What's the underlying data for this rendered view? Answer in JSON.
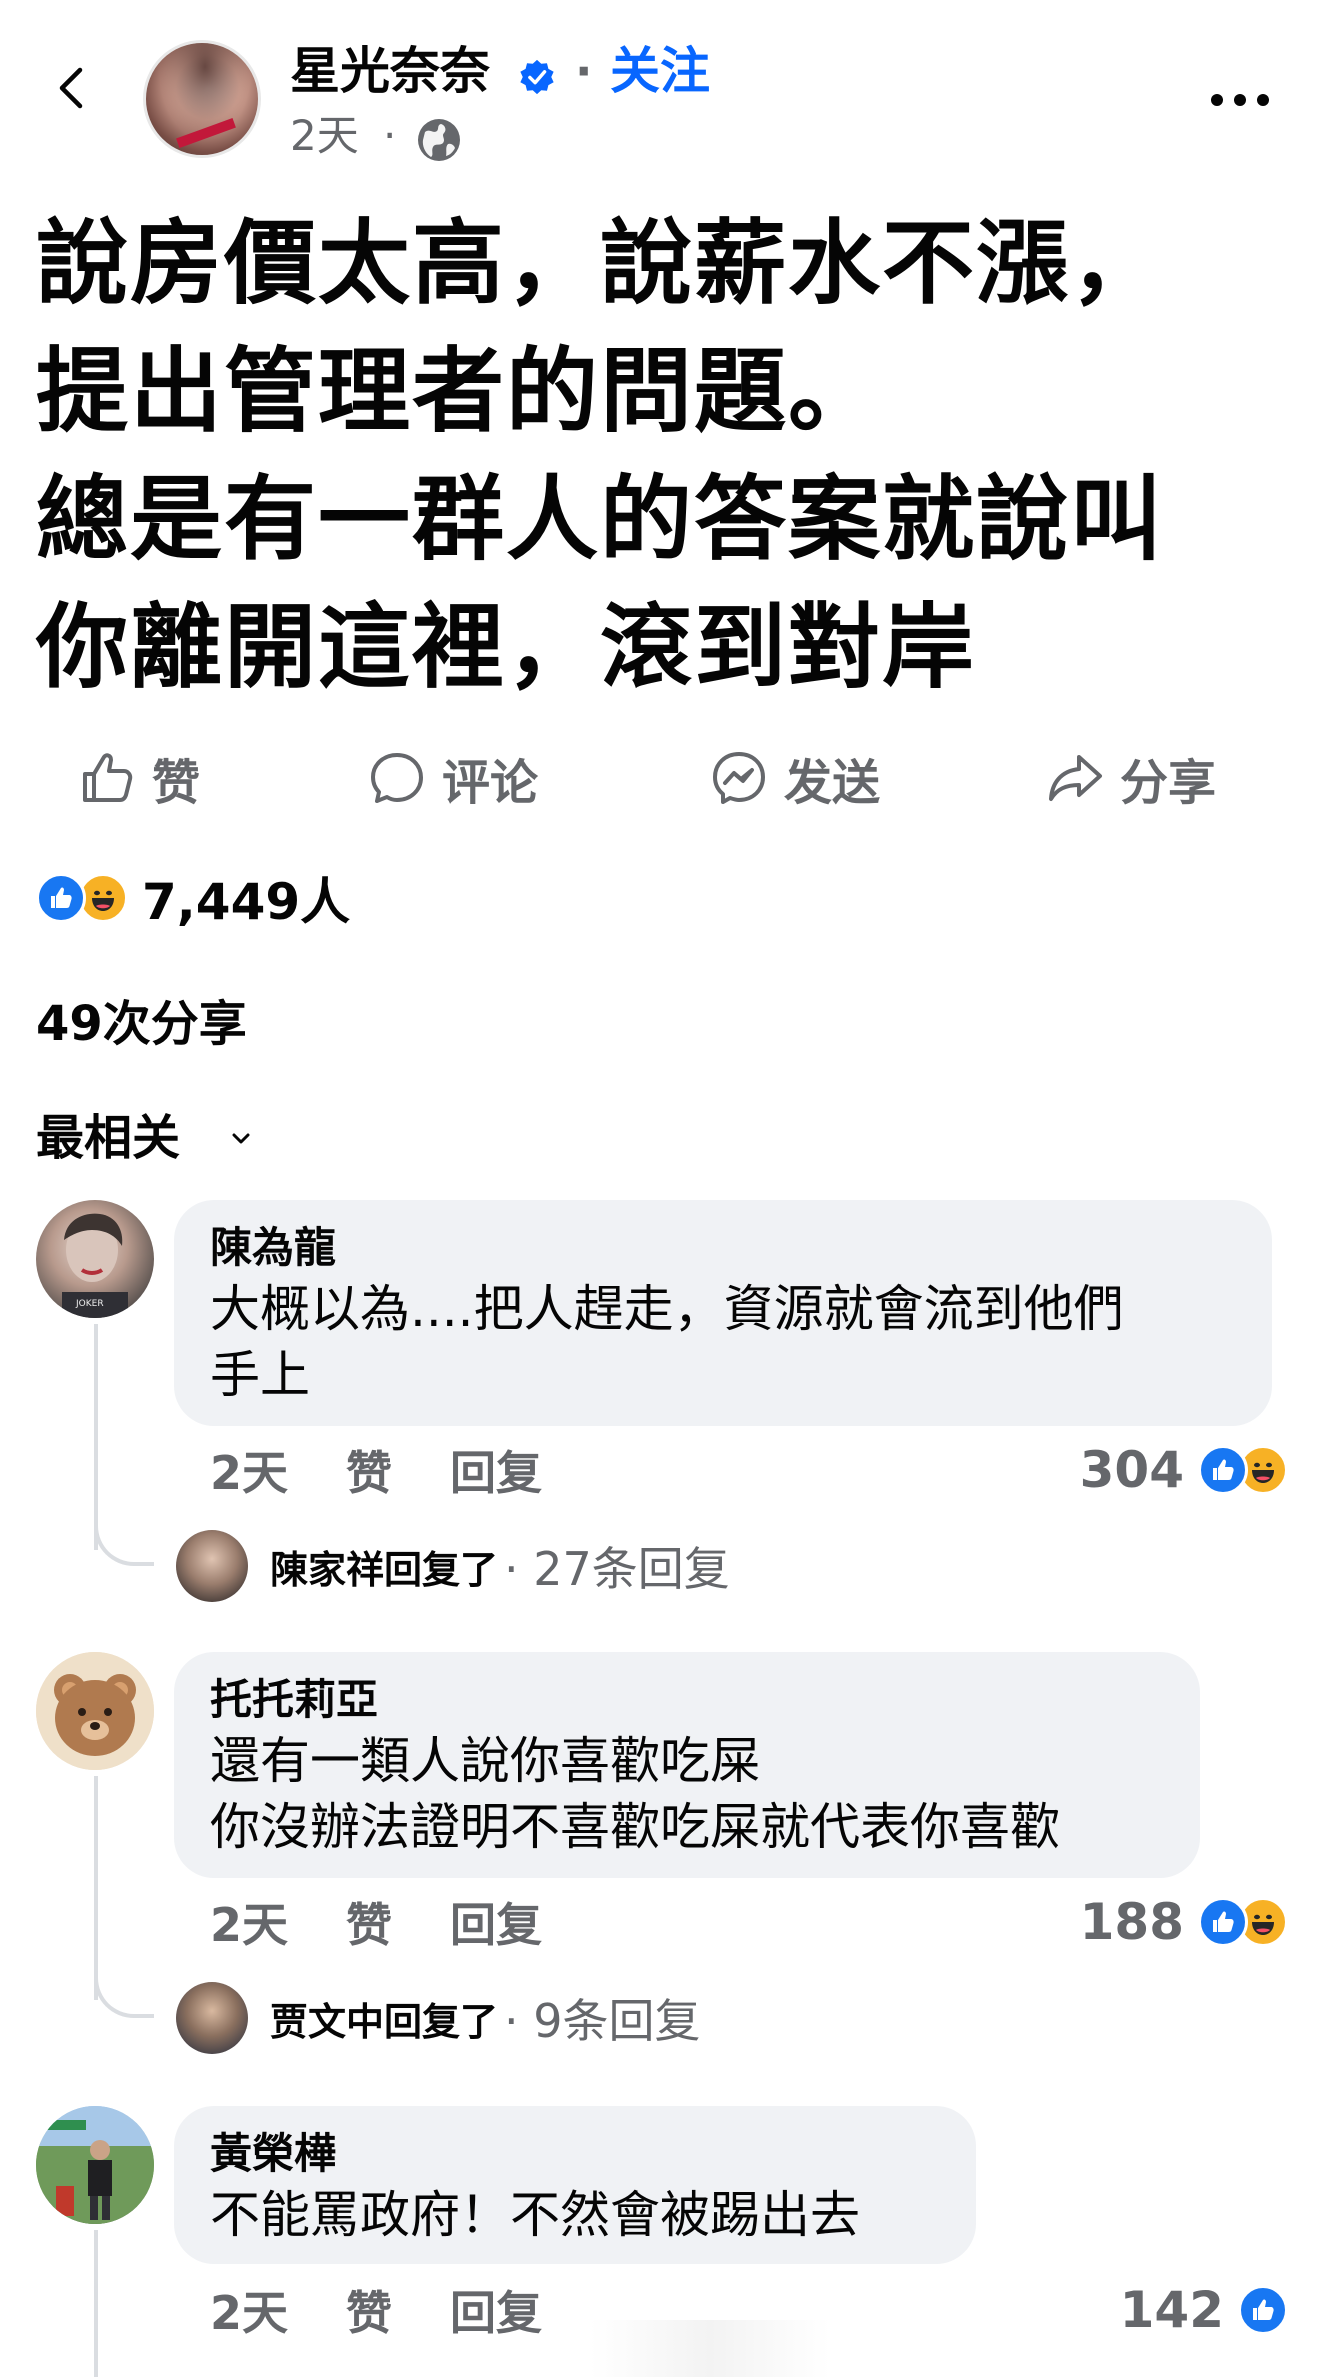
{
  "header": {
    "author_name": "星光奈奈",
    "dot": "·",
    "follow_label": "关注",
    "post_time": "2天",
    "time_dot": "·",
    "icons": [
      "chevron-left-icon",
      "verified-badge-icon",
      "globe-icon",
      "more-horizontal-icon"
    ]
  },
  "post": {
    "text_lines": [
      "說房價太高，說薪水不漲，",
      "提出管理者的問題。",
      "總是有一群人的答案就說叫",
      "你離開這裡，滾到對岸"
    ]
  },
  "actions": {
    "like_label": "赞",
    "comment_label": "评论",
    "send_label": "发送",
    "share_label": "分享"
  },
  "stats": {
    "reaction_count": "7,449人",
    "share_count": "49次分享",
    "sort_label": "最相关"
  },
  "comments": [
    {
      "name": "陳為龍",
      "lines": [
        "大概以為....把人趕走，資源就會流到他們",
        "手上"
      ],
      "time": "2天",
      "like_label": "赞",
      "reply_label": "回复",
      "reaction_count": "304",
      "reply_author": "陳家祥回复了",
      "reply_count": "· 27条回复"
    },
    {
      "name": "托托莉亞",
      "lines": [
        "還有一類人說你喜歡吃屎",
        "你沒辦法證明不喜歡吃屎就代表你喜歡"
      ],
      "time": "2天",
      "like_label": "赞",
      "reply_label": "回复",
      "reaction_count": "188",
      "reply_author": "贾文中回复了",
      "reply_count": "· 9条回复"
    },
    {
      "name": "黃榮樺",
      "lines": [
        "不能罵政府！不然會被踢出去"
      ],
      "time": "2天",
      "like_label": "赞",
      "reply_label": "回复",
      "reaction_count": "142"
    }
  ],
  "colors": {
    "accent_blue": "#0866ff",
    "like_blue": "#1877f2",
    "haha_yellow": "#f7b125",
    "secondary_text": "#65676b",
    "bubble_bg": "#f0f2f5"
  }
}
